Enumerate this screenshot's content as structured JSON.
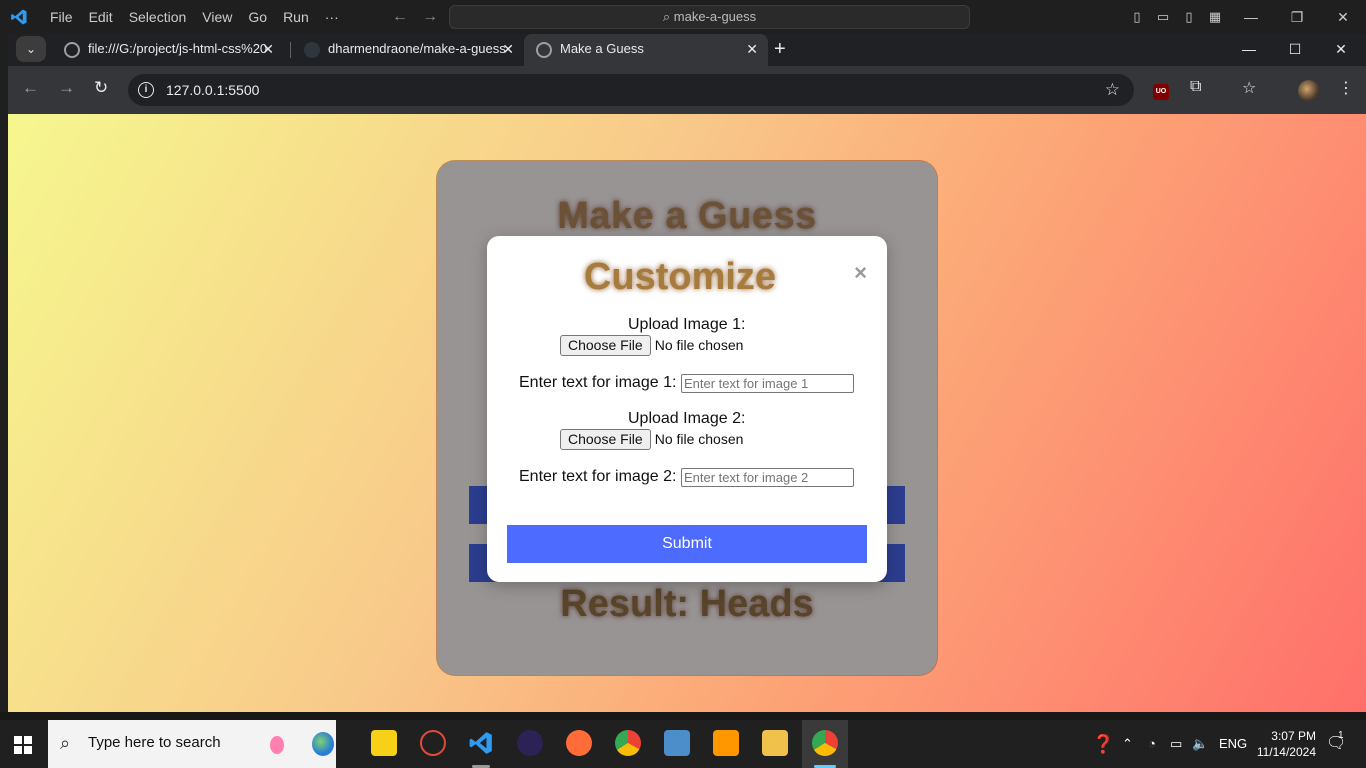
{
  "vscode": {
    "menu": [
      "File",
      "Edit",
      "Selection",
      "View",
      "Go",
      "Run",
      "···"
    ],
    "search": "make-a-guess"
  },
  "browser": {
    "tabs": [
      {
        "title": "file:///G:/project/js-html-css%20"
      },
      {
        "title": "dharmendraone/make-a-guess"
      },
      {
        "title": "Make a Guess"
      }
    ],
    "url": "127.0.0.1:5500"
  },
  "page": {
    "title": "Make a Guess",
    "result": "Result: Heads"
  },
  "modal": {
    "title": "Customize",
    "close": "×",
    "upload1_label": "Upload Image 1:",
    "upload2_label": "Upload Image 2:",
    "choose_file": "Choose File",
    "no_file": "No file chosen",
    "text1_label": "Enter text for image 1:",
    "text2_label": "Enter text for image 2:",
    "text1_placeholder": "Enter text for image 1",
    "text2_placeholder": "Enter text for image 2",
    "submit": "Submit"
  },
  "taskbar": {
    "search_placeholder": "Type here to search",
    "language": "ENG",
    "time": "3:07 PM",
    "date": "11/14/2024",
    "notifications": "1"
  },
  "colors": {
    "accent": "#4d6bfe",
    "game_button": "#2c3d8f",
    "modal_title": "#a77b3c"
  }
}
